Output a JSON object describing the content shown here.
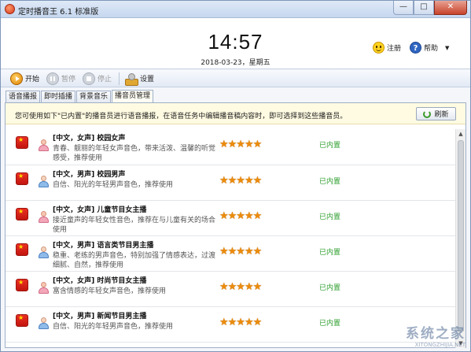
{
  "window": {
    "title": "定时播音王 6.1 标准版",
    "min": "—",
    "max": "□",
    "close": "✕"
  },
  "header": {
    "time": "14:57",
    "date": "2018-03-23，星期五",
    "register_label": "注册",
    "help_label": "帮助",
    "help_glyph": "?",
    "menu_caret": "▼"
  },
  "toolbar": {
    "start_label": "开始",
    "pause_label": "暂停",
    "stop_label": "停止",
    "settings_label": "设置"
  },
  "tabs": [
    {
      "label": "语音播报",
      "active": false
    },
    {
      "label": "即时插播",
      "active": false
    },
    {
      "label": "背景音乐",
      "active": false
    },
    {
      "label": "播音员管理",
      "active": true
    }
  ],
  "notice": {
    "text": "您可使用如下\"已内置\"的播音员进行语音播报，在语音任务中编辑播音稿内容时，即可选择到这些播音员。",
    "refresh_label": "刷新"
  },
  "voices": [
    {
      "gender": "female",
      "title": "[中文，女声] 校园女声",
      "desc": "青春、靓丽的年轻女声音色，带来活泼、温馨的听觉感受，推荐使用",
      "stars": "★★★★★",
      "rating": 5,
      "status": "已内置"
    },
    {
      "gender": "male",
      "title": "[中文，男声] 校园男声",
      "desc": "自信、阳光的年轻男声音色，推荐使用",
      "stars": "★★★★★",
      "rating": 5,
      "status": "已内置"
    },
    {
      "gender": "female",
      "title": "[中文，女声] 儿童节目女主播",
      "desc": "接近童声的年轻女性音色，推荐在与儿童有关的场合使用",
      "stars": "★★★★★",
      "rating": 5,
      "status": "已内置"
    },
    {
      "gender": "male",
      "title": "[中文，男声] 语言类节目男主播",
      "desc": "稳重、老练的男声音色，特别加强了情感表达，过渡细腻、自然，推荐使用",
      "stars": "★★★★★",
      "rating": 5,
      "status": "已内置"
    },
    {
      "gender": "female",
      "title": "[中文，女声] 时尚节目女主播",
      "desc": "富含情感的年轻女声音色，推荐使用",
      "stars": "★★★★★",
      "rating": 5,
      "status": "已内置"
    },
    {
      "gender": "male",
      "title": "[中文，男声] 新闻节目男主播",
      "desc": "自信、阳光的年轻男声音色，推荐使用",
      "stars": "★★★★★",
      "rating": 5,
      "status": "已内置"
    }
  ],
  "scrollbar": {
    "up": "▲",
    "down": "▼"
  },
  "watermark": {
    "main": "系统之家",
    "sub": "XITONGZHIJIA.NET"
  }
}
